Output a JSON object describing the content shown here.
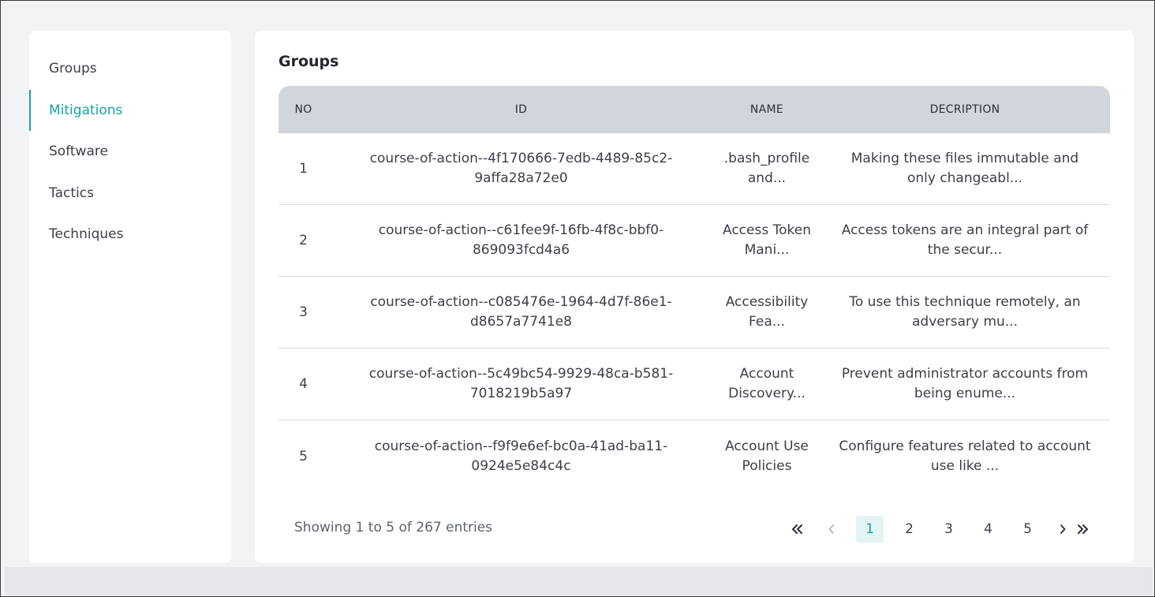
{
  "sidebar": {
    "items": [
      {
        "label": "Groups",
        "active": false
      },
      {
        "label": "Mitigations",
        "active": true
      },
      {
        "label": "Software",
        "active": false
      },
      {
        "label": "Tactics",
        "active": false
      },
      {
        "label": "Techniques",
        "active": false
      }
    ]
  },
  "main": {
    "title": "Groups",
    "table": {
      "headers": {
        "no": "NO",
        "id": "ID",
        "name": "NAME",
        "description": "DECRIPTION"
      },
      "rows": [
        {
          "no": "1",
          "id": "course-of-action--4f170666-7edb-4489-85c2-9affa28a72e0",
          "name": ".bash_profile and...",
          "description": "Making these files immutable and only changeabl..."
        },
        {
          "no": "2",
          "id": "course-of-action--c61fee9f-16fb-4f8c-bbf0-869093fcd4a6",
          "name": "Access Token Mani...",
          "description": "Access tokens are an integral part of the secur..."
        },
        {
          "no": "3",
          "id": "course-of-action--c085476e-1964-4d7f-86e1-d8657a7741e8",
          "name": "Accessibility Fea...",
          "description": "To use this technique remotely, an adversary mu..."
        },
        {
          "no": "4",
          "id": "course-of-action--5c49bc54-9929-48ca-b581-7018219b5a97",
          "name": "Account Discovery...",
          "description": "Prevent administrator accounts from being enume..."
        },
        {
          "no": "5",
          "id": "course-of-action--f9f9e6ef-bc0a-41ad-ba11-0924e5e84c4c",
          "name": "Account Use Policies",
          "description": "Configure features related to account use like ..."
        }
      ]
    },
    "footer": {
      "showing": "Showing 1 to 5 of 267 entries"
    },
    "pagination": {
      "pages": [
        "1",
        "2",
        "3",
        "4",
        "5"
      ],
      "current": "1"
    }
  },
  "colors": {
    "accent": "#17a3a3",
    "header_bg": "#d2d5dc",
    "page_bg": "#f2f3f5"
  }
}
